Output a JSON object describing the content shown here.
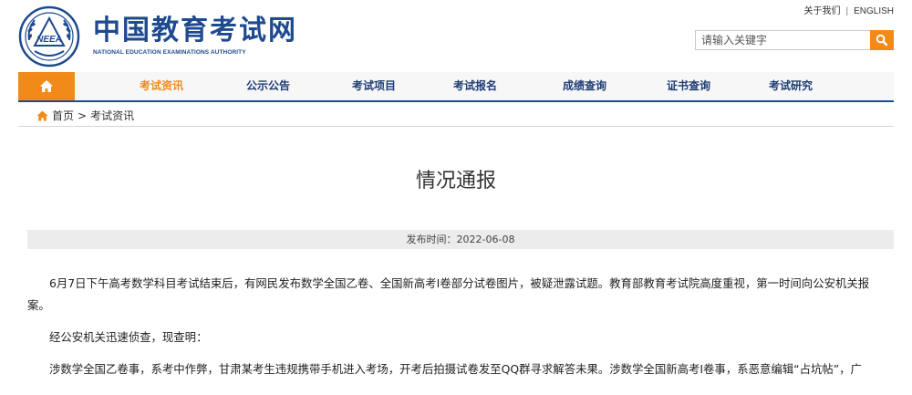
{
  "site": {
    "name_cn": "中国教育考试网",
    "name_en": "NATIONAL EDUCATION EXAMINATIONS AUTHORITY",
    "emblem_text": "NEEA"
  },
  "top_links": {
    "about": "关于我们",
    "separator": "|",
    "english": "ENGLISH"
  },
  "search": {
    "placeholder": "请输入关键字",
    "icon": "search-icon"
  },
  "nav": {
    "home_icon": "home-icon",
    "items": [
      {
        "label": "考试资讯",
        "active": true
      },
      {
        "label": "公示公告",
        "active": false
      },
      {
        "label": "考试项目",
        "active": false
      },
      {
        "label": "考试报名",
        "active": false
      },
      {
        "label": "成绩查询",
        "active": false
      },
      {
        "label": "证书查询",
        "active": false
      },
      {
        "label": "考试研究",
        "active": false
      }
    ]
  },
  "breadcrumb": {
    "home": "首页",
    "separator": ">",
    "current": "考试资讯"
  },
  "article": {
    "title": "情况通报",
    "publish_label": "发布时间：2022-06-08",
    "paragraphs": [
      "6月7日下午高考数学科目考试结束后，有网民发布数学全国乙卷、全国新高考I卷部分试卷图片，被疑泄露试题。教育部教育考试院高度重视，第一时间向公安机关报",
      "案。",
      "经公安机关迅速侦查，现查明：",
      "涉数学全国乙卷事，系考中作弊，甘肃某考生违规携带手机进入考场，开考后拍摄试卷发至QQ群寻求解答未果。涉数学全国新高考I卷事，系恶意编辑“占坑帖”，广"
    ]
  },
  "colors": {
    "brand_blue": "#1e4a8f",
    "accent_orange": "#f28a1a",
    "nav_bg": "#f7f7f7",
    "pub_bar_bg": "#ececec"
  }
}
